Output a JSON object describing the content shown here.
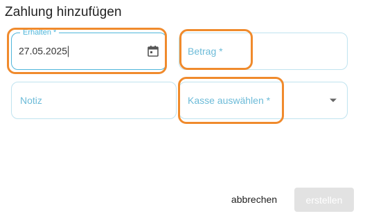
{
  "dialog": {
    "title": "Zahlung hinzufügen"
  },
  "fields": {
    "received": {
      "label": "Erhalten *",
      "value": "27.05.2025",
      "icon": "calendar-icon"
    },
    "amount": {
      "label": "Betrag *"
    },
    "note": {
      "label": "Notiz"
    },
    "cash_register": {
      "label": "Kasse auswählen *",
      "icon": "chevron-down-icon"
    }
  },
  "actions": {
    "cancel_label": "abbrechen",
    "create_label": "erstellen"
  },
  "colors": {
    "accent": "#4fb6da",
    "field_border": "#bfe3ef",
    "highlight": "#f08a2c",
    "disabled_button": "#e2e2e2"
  }
}
